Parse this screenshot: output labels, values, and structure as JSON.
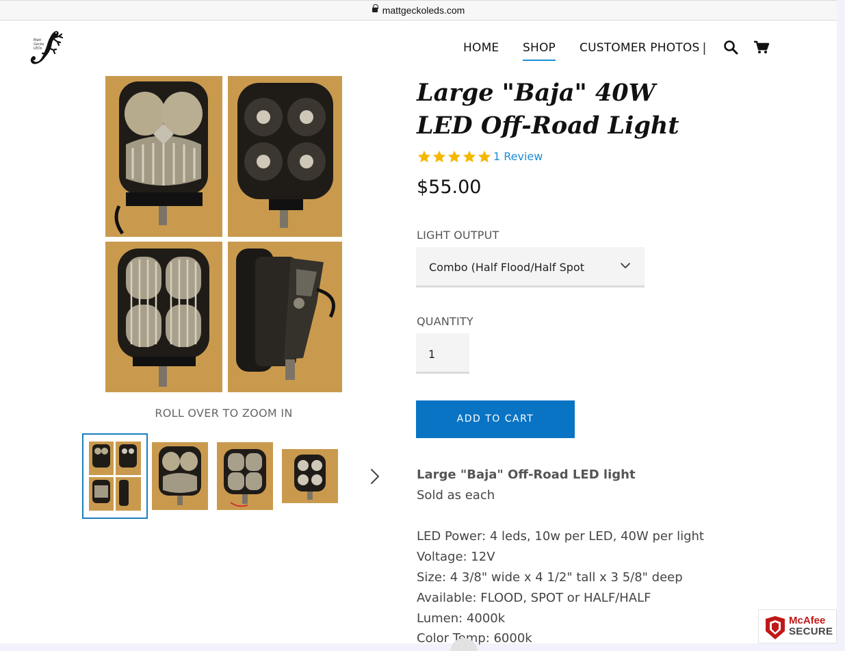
{
  "browser": {
    "url": "mattgeckoleds.com"
  },
  "header": {
    "logo_text": [
      "Matt",
      "Gecko",
      "LEDs"
    ],
    "nav": {
      "home": "HOME",
      "shop": "SHOP",
      "customer_photos": "CUSTOMER PHOTOS",
      "separator": "|"
    },
    "icons": [
      "search-icon",
      "cart-icon"
    ]
  },
  "gallery": {
    "zoom_hint": "ROLL OVER TO ZOOM IN",
    "thumbnail_count": 4,
    "selected_thumbnail": 1
  },
  "product": {
    "title_line1": "Large \"Baja\" 40W",
    "title_line2": "LED Off-Road Light",
    "rating_stars": 5,
    "review_link": "1 Review",
    "price": "$55.00",
    "option_label": "LIGHT OUTPUT",
    "option_value": "Combo (Half Flood/Half Spot",
    "quantity_label": "QUANTITY",
    "quantity_value": "1",
    "add_to_cart": "ADD TO CART"
  },
  "description": {
    "line1": "Large \"Baja\" Off-Road LED light",
    "line2": "Sold as each",
    "line3": "LED Power: 4 leds, 10w per LED, 40W per light",
    "line4": "Voltage: 12V",
    "line5": "Size: 4 3/8\" wide x 4 1/2\" tall x 3 5/8\" deep",
    "line6": "Available: FLOOD, SPOT or HALF/HALF",
    "line7": "Lumen: 4000k",
    "line8": "Color Temp: 6000k"
  },
  "badge": {
    "brand": "McAfee",
    "text": "SECURE"
  },
  "colors": {
    "accent": "#1a8ed6",
    "button": "#0a74c4",
    "star": "#f5b800",
    "carpet": "#c99a4e"
  }
}
